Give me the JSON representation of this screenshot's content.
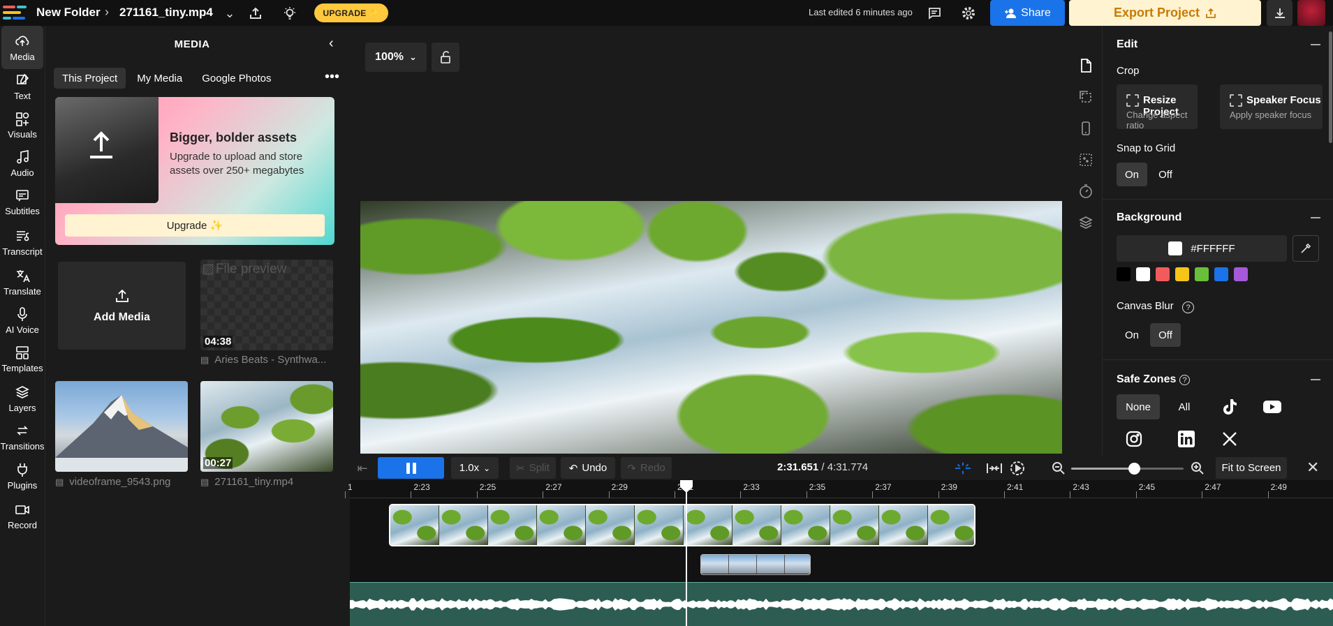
{
  "topbar": {
    "folder": "New Folder",
    "file": "271161_tiny.mp4",
    "upgrade": "UPGRADE ✨",
    "last_edited": "Last edited 6 minutes ago",
    "share": "Share",
    "export": "Export Project"
  },
  "rail": [
    {
      "label": "Media",
      "icon": "upload-cloud-icon",
      "active": true
    },
    {
      "label": "Text",
      "icon": "text-edit-icon"
    },
    {
      "label": "Visuals",
      "icon": "shapes-icon"
    },
    {
      "label": "Audio",
      "icon": "music-note-icon"
    },
    {
      "label": "Subtitles",
      "icon": "subtitles-icon"
    },
    {
      "label": "Transcript",
      "icon": "transcript-icon"
    },
    {
      "label": "Translate",
      "icon": "translate-icon"
    },
    {
      "label": "AI Voice",
      "icon": "microphone-icon"
    },
    {
      "label": "Templates",
      "icon": "templates-icon"
    },
    {
      "label": "Layers",
      "icon": "layers-icon"
    },
    {
      "label": "Transitions",
      "icon": "transitions-icon"
    },
    {
      "label": "Plugins",
      "icon": "plug-icon"
    },
    {
      "label": "Record",
      "icon": "camera-icon"
    }
  ],
  "media": {
    "title": "MEDIA",
    "tabs": [
      "This Project",
      "My Media",
      "Google Photos"
    ],
    "promo": {
      "title": "Bigger, bolder assets",
      "text": "Upgrade to upload and store assets over 250+ megabytes",
      "button": "Upgrade ✨"
    },
    "add_media": "Add Media",
    "items": [
      {
        "alt": "File preview",
        "duration": "04:38",
        "caption": "Aries Beats - Synthwa..."
      },
      {
        "caption": "videoframe_9543.png"
      },
      {
        "duration": "00:27",
        "caption": "271161_tiny.mp4"
      }
    ]
  },
  "canvas": {
    "zoom": "100%"
  },
  "props": {
    "edit_title": "Edit",
    "crop_label": "Crop",
    "resize": {
      "title": "Resize Project",
      "sub": "Change aspect ratio"
    },
    "speaker": {
      "title": "Speaker Focus",
      "sub": "Apply speaker focus"
    },
    "snap_label": "Snap to Grid",
    "snap_on": "On",
    "snap_off": "Off",
    "background_title": "Background",
    "bg_color": "#FFFFFF",
    "swatches": [
      "#000000",
      "#ffffff",
      "#f15b5b",
      "#f5c518",
      "#6abf3a",
      "#1a73e8",
      "#a559d9"
    ],
    "blur_label": "Canvas Blur",
    "blur_on": "On",
    "blur_off": "Off",
    "safe_title": "Safe Zones",
    "safe_none": "None",
    "safe_all": "All",
    "social": [
      "tiktok-icon",
      "youtube-icon",
      "instagram-icon",
      "linkedin-icon",
      "x-icon"
    ]
  },
  "timeline": {
    "speed": "1.0x",
    "split": "Split",
    "undo": "Undo",
    "redo": "Redo",
    "current": "2:31.651",
    "total": "4:31.774",
    "fit": "Fit to Screen",
    "zoom_level": 0.56,
    "ticks": [
      "1",
      "2:23",
      "2:25",
      "2:27",
      "2:29",
      "2:31",
      "2:33",
      "2:35",
      "2:37",
      "2:39",
      "2:41",
      "2:43",
      "2:45",
      "2:47",
      "2:49"
    ]
  }
}
